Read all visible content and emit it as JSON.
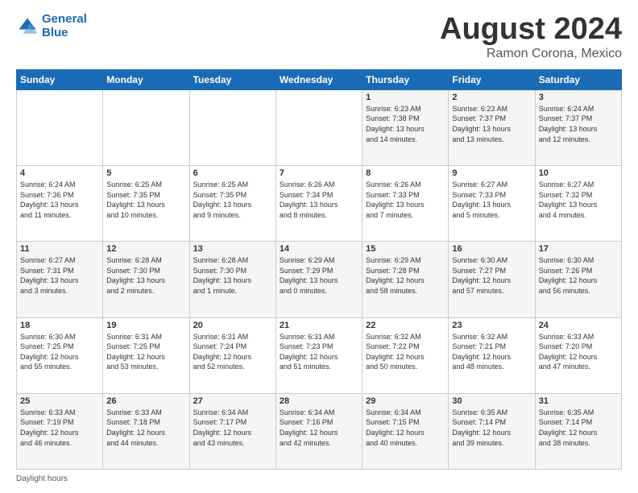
{
  "header": {
    "logo_line1": "General",
    "logo_line2": "Blue",
    "main_title": "August 2024",
    "subtitle": "Ramon Corona, Mexico"
  },
  "days_of_week": [
    "Sunday",
    "Monday",
    "Tuesday",
    "Wednesday",
    "Thursday",
    "Friday",
    "Saturday"
  ],
  "footer_label": "Daylight hours",
  "weeks": [
    [
      {
        "day": "",
        "info": ""
      },
      {
        "day": "",
        "info": ""
      },
      {
        "day": "",
        "info": ""
      },
      {
        "day": "",
        "info": ""
      },
      {
        "day": "1",
        "info": "Sunrise: 6:23 AM\nSunset: 7:38 PM\nDaylight: 13 hours\nand 14 minutes."
      },
      {
        "day": "2",
        "info": "Sunrise: 6:23 AM\nSunset: 7:37 PM\nDaylight: 13 hours\nand 13 minutes."
      },
      {
        "day": "3",
        "info": "Sunrise: 6:24 AM\nSunset: 7:37 PM\nDaylight: 13 hours\nand 12 minutes."
      }
    ],
    [
      {
        "day": "4",
        "info": "Sunrise: 6:24 AM\nSunset: 7:36 PM\nDaylight: 13 hours\nand 11 minutes."
      },
      {
        "day": "5",
        "info": "Sunrise: 6:25 AM\nSunset: 7:35 PM\nDaylight: 13 hours\nand 10 minutes."
      },
      {
        "day": "6",
        "info": "Sunrise: 6:25 AM\nSunset: 7:35 PM\nDaylight: 13 hours\nand 9 minutes."
      },
      {
        "day": "7",
        "info": "Sunrise: 6:26 AM\nSunset: 7:34 PM\nDaylight: 13 hours\nand 8 minutes."
      },
      {
        "day": "8",
        "info": "Sunrise: 6:26 AM\nSunset: 7:33 PM\nDaylight: 13 hours\nand 7 minutes."
      },
      {
        "day": "9",
        "info": "Sunrise: 6:27 AM\nSunset: 7:33 PM\nDaylight: 13 hours\nand 5 minutes."
      },
      {
        "day": "10",
        "info": "Sunrise: 6:27 AM\nSunset: 7:32 PM\nDaylight: 13 hours\nand 4 minutes."
      }
    ],
    [
      {
        "day": "11",
        "info": "Sunrise: 6:27 AM\nSunset: 7:31 PM\nDaylight: 13 hours\nand 3 minutes."
      },
      {
        "day": "12",
        "info": "Sunrise: 6:28 AM\nSunset: 7:30 PM\nDaylight: 13 hours\nand 2 minutes."
      },
      {
        "day": "13",
        "info": "Sunrise: 6:28 AM\nSunset: 7:30 PM\nDaylight: 13 hours\nand 1 minute."
      },
      {
        "day": "14",
        "info": "Sunrise: 6:29 AM\nSunset: 7:29 PM\nDaylight: 13 hours\nand 0 minutes."
      },
      {
        "day": "15",
        "info": "Sunrise: 6:29 AM\nSunset: 7:28 PM\nDaylight: 12 hours\nand 58 minutes."
      },
      {
        "day": "16",
        "info": "Sunrise: 6:30 AM\nSunset: 7:27 PM\nDaylight: 12 hours\nand 57 minutes."
      },
      {
        "day": "17",
        "info": "Sunrise: 6:30 AM\nSunset: 7:26 PM\nDaylight: 12 hours\nand 56 minutes."
      }
    ],
    [
      {
        "day": "18",
        "info": "Sunrise: 6:30 AM\nSunset: 7:25 PM\nDaylight: 12 hours\nand 55 minutes."
      },
      {
        "day": "19",
        "info": "Sunrise: 6:31 AM\nSunset: 7:25 PM\nDaylight: 12 hours\nand 53 minutes."
      },
      {
        "day": "20",
        "info": "Sunrise: 6:31 AM\nSunset: 7:24 PM\nDaylight: 12 hours\nand 52 minutes."
      },
      {
        "day": "21",
        "info": "Sunrise: 6:31 AM\nSunset: 7:23 PM\nDaylight: 12 hours\nand 51 minutes."
      },
      {
        "day": "22",
        "info": "Sunrise: 6:32 AM\nSunset: 7:22 PM\nDaylight: 12 hours\nand 50 minutes."
      },
      {
        "day": "23",
        "info": "Sunrise: 6:32 AM\nSunset: 7:21 PM\nDaylight: 12 hours\nand 48 minutes."
      },
      {
        "day": "24",
        "info": "Sunrise: 6:33 AM\nSunset: 7:20 PM\nDaylight: 12 hours\nand 47 minutes."
      }
    ],
    [
      {
        "day": "25",
        "info": "Sunrise: 6:33 AM\nSunset: 7:19 PM\nDaylight: 12 hours\nand 46 minutes."
      },
      {
        "day": "26",
        "info": "Sunrise: 6:33 AM\nSunset: 7:18 PM\nDaylight: 12 hours\nand 44 minutes."
      },
      {
        "day": "27",
        "info": "Sunrise: 6:34 AM\nSunset: 7:17 PM\nDaylight: 12 hours\nand 43 minutes."
      },
      {
        "day": "28",
        "info": "Sunrise: 6:34 AM\nSunset: 7:16 PM\nDaylight: 12 hours\nand 42 minutes."
      },
      {
        "day": "29",
        "info": "Sunrise: 6:34 AM\nSunset: 7:15 PM\nDaylight: 12 hours\nand 40 minutes."
      },
      {
        "day": "30",
        "info": "Sunrise: 6:35 AM\nSunset: 7:14 PM\nDaylight: 12 hours\nand 39 minutes."
      },
      {
        "day": "31",
        "info": "Sunrise: 6:35 AM\nSunset: 7:14 PM\nDaylight: 12 hours\nand 38 minutes."
      }
    ]
  ]
}
